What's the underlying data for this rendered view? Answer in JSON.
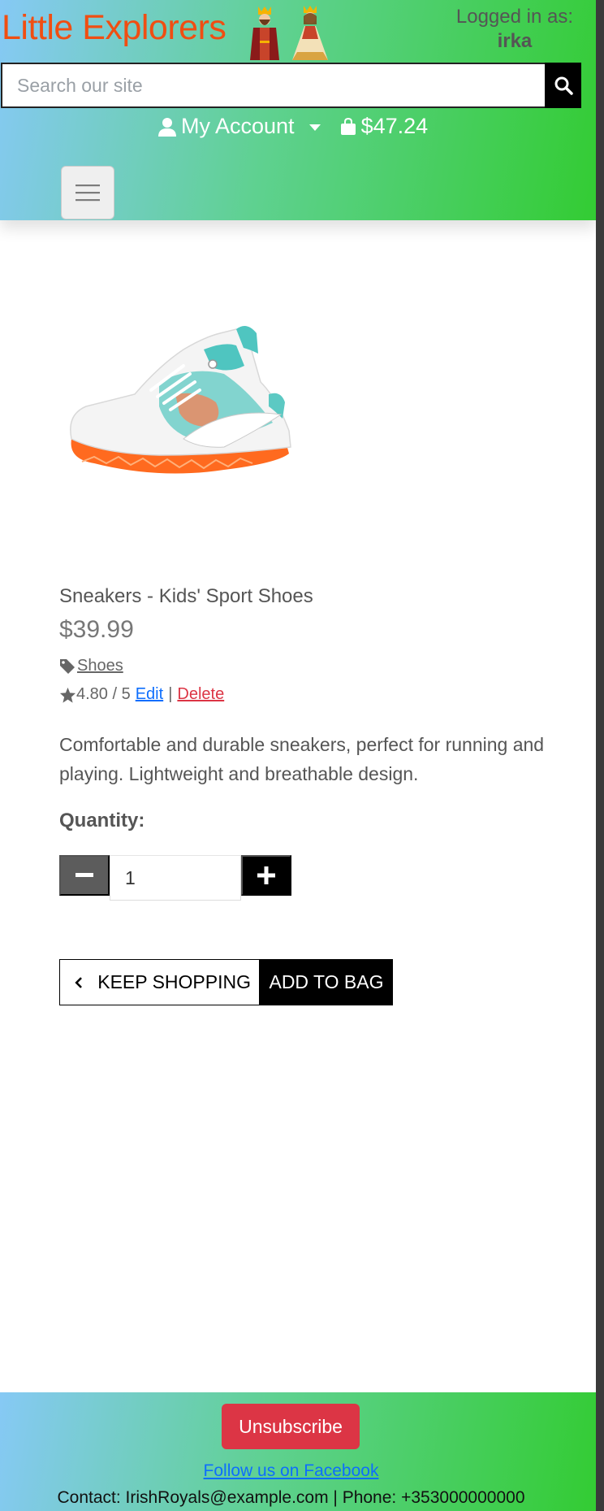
{
  "header": {
    "brand": "Little Explorers",
    "login_label": "Logged in as:",
    "login_user": "irka",
    "search_placeholder": "Search our site",
    "account_label": "My Account",
    "bag_total": "$47.24",
    "brand_color": "#f04e12"
  },
  "product": {
    "name": "Sneakers - Kids' Sport Shoes",
    "price": "$39.99",
    "category": "Shoes",
    "rating": "4.80 / 5",
    "edit_label": "Edit",
    "separator": "|",
    "delete_label": "Delete",
    "description": "Comfortable and durable sneakers, perfect for running and playing. Lightweight and breathable design.",
    "quantity_label": "Quantity:",
    "quantity_value": "1",
    "keep_shopping_label": "KEEP SHOPPING",
    "add_to_bag_label": "ADD TO BAG"
  },
  "footer": {
    "unsubscribe_label": "Unsubscribe",
    "facebook_link": "Follow us on Facebook",
    "contact": "Contact: IrishRoyals@example.com | Phone: +353000000000"
  },
  "icons": {
    "search": "search-icon",
    "account": "user-icon",
    "bag": "shopping-bag-icon",
    "menu": "hamburger-menu-icon",
    "tag": "tag-icon",
    "star": "star-icon",
    "minus": "minus-icon",
    "plus": "plus-icon",
    "back": "chevron-left-icon"
  }
}
